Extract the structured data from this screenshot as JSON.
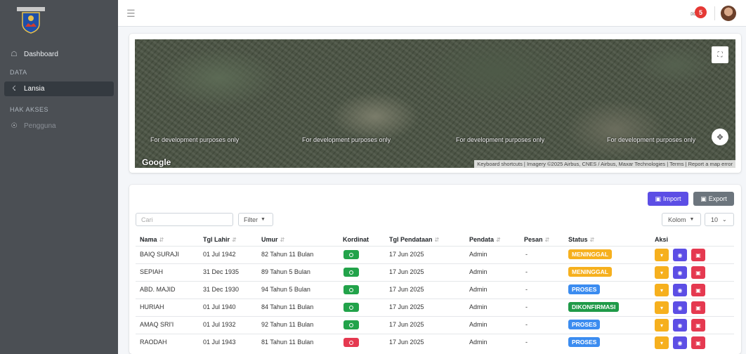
{
  "sidebar": {
    "nav": {
      "dashboard": "Dashboard",
      "lansia": "Lansia",
      "pengguna": "Pengguna"
    },
    "sections": {
      "data": "DATA",
      "hak_akses": "HAK AKSES"
    }
  },
  "topbar": {
    "notification_count": "5"
  },
  "map": {
    "watermark": "For development purposes only",
    "google_logo": "Google",
    "attribution": "Keyboard shortcuts | Imagery ©2025 Airbus, CNES / Airbus, Maxar Technologies | Terms | Report a map error"
  },
  "toolbar": {
    "import_label": "Import",
    "export_label": "Export",
    "search_placeholder": "Cari",
    "filter_label": "Filter",
    "kolom_label": "Kolom",
    "perpage_value": "10"
  },
  "table": {
    "headers": {
      "nama": "Nama",
      "tgl_lahir": "Tgl Lahir",
      "umur": "Umur",
      "kordinat": "Kordinat",
      "tgl_pendataan": "Tgl Pendataan",
      "pendata": "Pendata",
      "pesan": "Pesan",
      "status": "Status",
      "aksi": "Aksi"
    },
    "rows": [
      {
        "nama": "BAIQ SURAJI",
        "tgl_lahir": "01 Jul 1942",
        "umur": "82 Tahun 11 Bulan",
        "kordinat": "green",
        "tgl_pendataan": "17 Jun 2025",
        "pendata": "Admin",
        "pesan": "-",
        "status": "MENINGGAL",
        "status_color": "#f6b01e"
      },
      {
        "nama": "SEPIAH",
        "tgl_lahir": "31 Dec 1935",
        "umur": "89 Tahun 5 Bulan",
        "kordinat": "green",
        "tgl_pendataan": "17 Jun 2025",
        "pendata": "Admin",
        "pesan": "-",
        "status": "MENINGGAL",
        "status_color": "#f6b01e"
      },
      {
        "nama": "ABD. MAJID",
        "tgl_lahir": "31 Dec 1930",
        "umur": "94 Tahun 5 Bulan",
        "kordinat": "green",
        "tgl_pendataan": "17 Jun 2025",
        "pendata": "Admin",
        "pesan": "-",
        "status": "PROSES",
        "status_color": "#3b8cf0"
      },
      {
        "nama": "HURIAH",
        "tgl_lahir": "01 Jul 1940",
        "umur": "84 Tahun 11 Bulan",
        "kordinat": "green",
        "tgl_pendataan": "17 Jun 2025",
        "pendata": "Admin",
        "pesan": "-",
        "status": "DIKONFIRMASI",
        "status_color": "#1f9a48"
      },
      {
        "nama": "AMAQ SRI'I",
        "tgl_lahir": "01 Jul 1932",
        "umur": "92 Tahun 11 Bulan",
        "kordinat": "green",
        "tgl_pendataan": "17 Jun 2025",
        "pendata": "Admin",
        "pesan": "-",
        "status": "PROSES",
        "status_color": "#3b8cf0"
      },
      {
        "nama": "RAODAH",
        "tgl_lahir": "01 Jul 1943",
        "umur": "81 Tahun 11 Bulan",
        "kordinat": "red",
        "tgl_pendataan": "17 Jun 2025",
        "pendata": "Admin",
        "pesan": "-",
        "status": "PROSES",
        "status_color": "#3b8cf0"
      }
    ]
  },
  "colors": {
    "kordinat_green": "#22a34a",
    "kordinat_red": "#e53950",
    "accent": "#5c4ee5"
  }
}
